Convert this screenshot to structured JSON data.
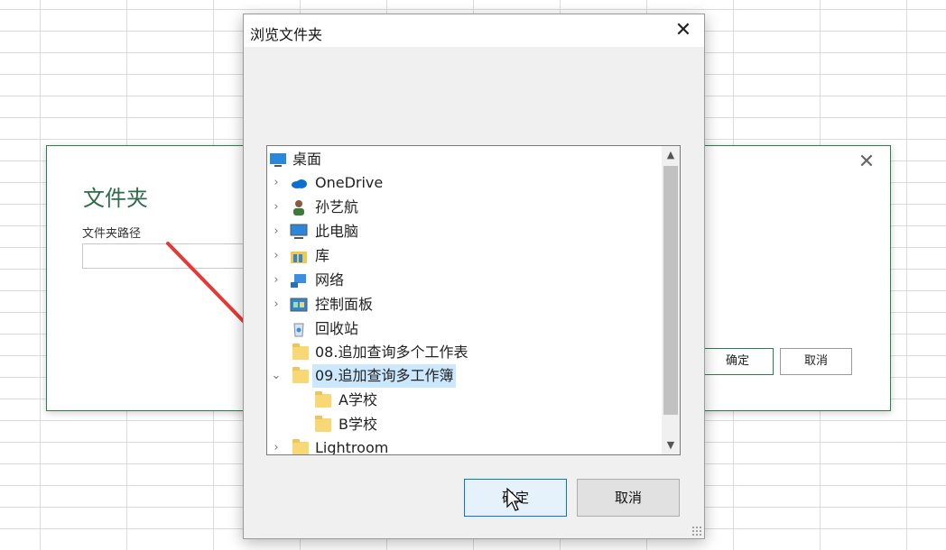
{
  "background_dialog": {
    "title": "文件夹",
    "path_label": "文件夹路径",
    "path_value": "",
    "close_glyph": "✕",
    "ok_label": "确定",
    "cancel_label": "取消"
  },
  "browse_dialog": {
    "title": "浏览文件夹",
    "close_glyph": "✕",
    "tree": [
      {
        "label": "桌面",
        "icon": "desktop-icon",
        "chevron": ""
      },
      {
        "label": "OneDrive",
        "icon": "cloud-icon",
        "chevron": "›"
      },
      {
        "label": "孙艺航",
        "icon": "user-icon",
        "chevron": "›"
      },
      {
        "label": "此电脑",
        "icon": "computer-icon",
        "chevron": "›"
      },
      {
        "label": "库",
        "icon": "library-icon",
        "chevron": "›"
      },
      {
        "label": "网络",
        "icon": "network-icon",
        "chevron": "›"
      },
      {
        "label": "控制面板",
        "icon": "control-panel-icon",
        "chevron": "›"
      },
      {
        "label": "回收站",
        "icon": "recycle-bin-icon",
        "chevron": ""
      },
      {
        "label": "08.追加查询多个工作表",
        "icon": "folder-icon",
        "chevron": ""
      },
      {
        "label": "09.追加查询多工作簿",
        "icon": "folder-icon",
        "chevron": "⌄"
      },
      {
        "label": "A学校",
        "icon": "folder-icon",
        "chevron": ""
      },
      {
        "label": "B学校",
        "icon": "folder-icon",
        "chevron": ""
      },
      {
        "label": "Lightroom",
        "icon": "folder-icon",
        "chevron": "›"
      }
    ],
    "ok_label": "确定",
    "cancel_label": "取消"
  },
  "colors": {
    "accent_green": "#2f7d4e",
    "selection_blue": "#cce8ff",
    "annotation_red": "#e53935",
    "button_focus_blue": "#0078d7"
  }
}
